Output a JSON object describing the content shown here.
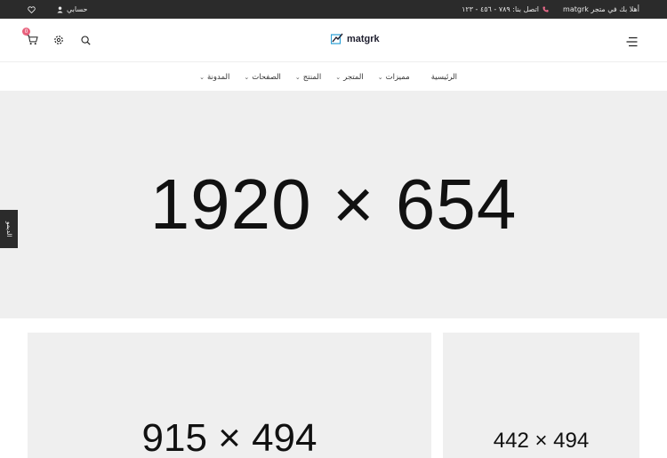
{
  "topbar": {
    "welcome": "أهلا بك في متجر matgrk",
    "phone": "اتصل بنا: ٧٨٩ - ٤٥٦ - ١٢٣",
    "account": "حسابي"
  },
  "header": {
    "logo_text": "matgrk",
    "cart_count": "0"
  },
  "nav": {
    "items": [
      {
        "label": "الرئيسية"
      },
      {
        "label": "مميزات"
      },
      {
        "label": "المتجر"
      },
      {
        "label": "المنتج"
      },
      {
        "label": "الصفحات"
      },
      {
        "label": "المدونة"
      }
    ]
  },
  "hero": {
    "label": "1920 × 654"
  },
  "side_tab": {
    "label": "الديمو"
  },
  "banners": [
    {
      "label": "915 × 494"
    },
    {
      "label": "442 × 494"
    }
  ],
  "colors": {
    "topbar_bg": "#2b2b2b",
    "placeholder_bg": "#efefef",
    "accent": "#e8617c"
  }
}
